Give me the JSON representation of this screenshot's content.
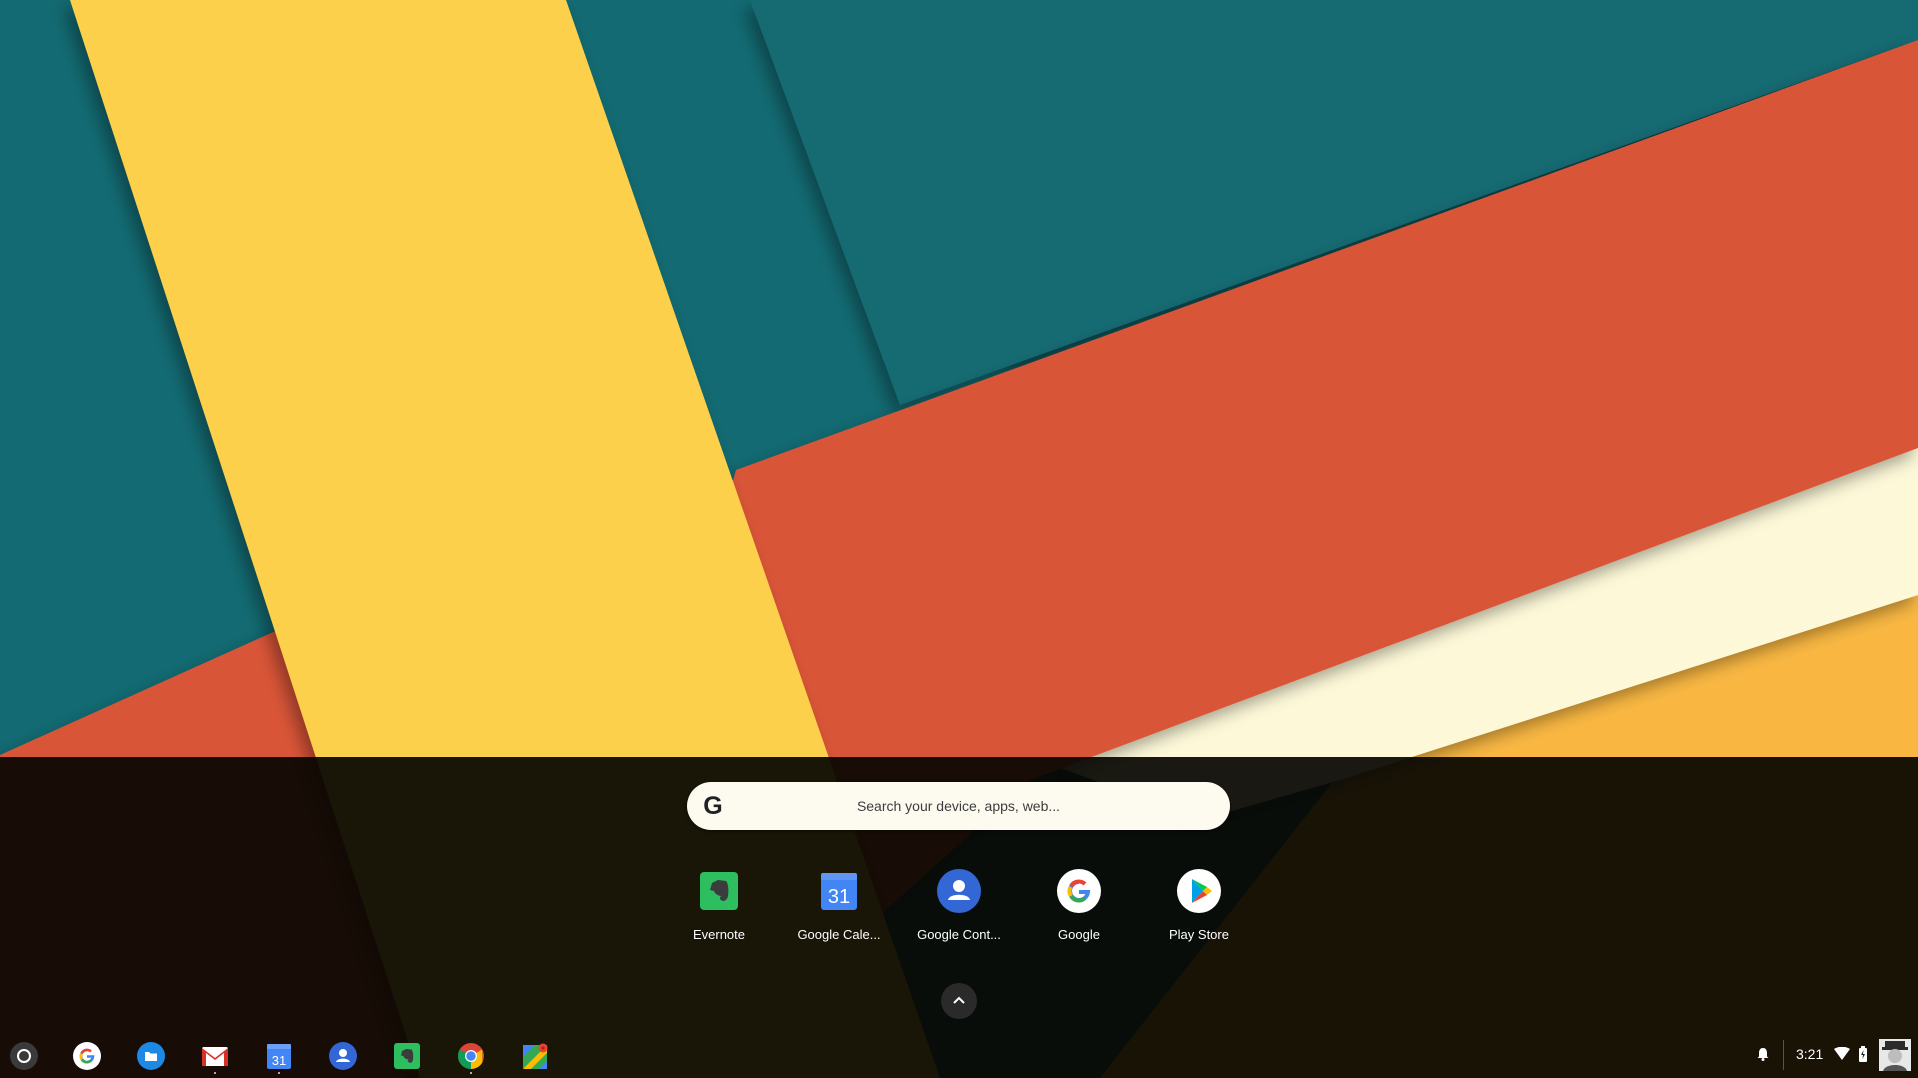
{
  "wallpaper": {
    "colors": {
      "teal": "#136a72",
      "yellow": "#fdd04c",
      "orange_red": "#d95538",
      "cream": "#fdf8d8",
      "amber": "#f9b742"
    }
  },
  "launcher": {
    "search": {
      "logo": "G",
      "placeholder": "Search your device, apps, web..."
    },
    "apps": [
      {
        "label": "Evernote",
        "icon": "evernote-icon"
      },
      {
        "label": "Google Cale...",
        "icon": "google-calendar-icon",
        "icon_text": "31"
      },
      {
        "label": "Google Cont...",
        "icon": "google-contacts-icon"
      },
      {
        "label": "Google",
        "icon": "google-icon"
      },
      {
        "label": "Play Store",
        "icon": "play-store-icon"
      }
    ],
    "expand_icon": "chevron-up-icon"
  },
  "shelf": {
    "items": [
      {
        "name": "launcher-button",
        "icon": "launcher-circle-icon"
      },
      {
        "name": "google",
        "icon": "google-icon"
      },
      {
        "name": "files",
        "icon": "files-icon"
      },
      {
        "name": "gmail",
        "icon": "gmail-icon",
        "running": true
      },
      {
        "name": "google-calendar",
        "icon": "google-calendar-icon",
        "icon_text": "31",
        "running": true
      },
      {
        "name": "google-contacts",
        "icon": "google-contacts-icon"
      },
      {
        "name": "evernote",
        "icon": "evernote-icon"
      },
      {
        "name": "chrome",
        "icon": "chrome-icon",
        "running": true
      },
      {
        "name": "google-maps",
        "icon": "google-maps-icon"
      }
    ],
    "status": {
      "time": "3:21",
      "icons": [
        "bell-icon",
        "wifi-icon",
        "battery-icon",
        "avatar"
      ]
    }
  }
}
